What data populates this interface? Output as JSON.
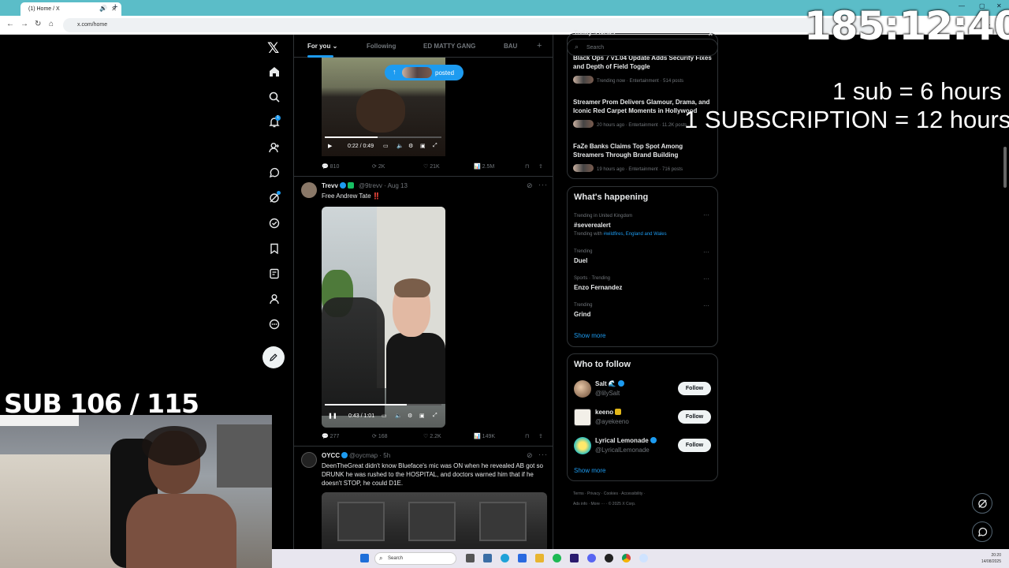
{
  "browser": {
    "tab_title": "(1) Home / X",
    "url": "x.com/home"
  },
  "feed": {
    "tabs": [
      {
        "label": "For you"
      },
      {
        "label": "Following"
      },
      {
        "label": "ED MATTY GANG"
      },
      {
        "label": "BAU"
      }
    ],
    "posted_pill": "posted",
    "tweet1": {
      "video_time": "0:22 / 0:49",
      "replies": "810",
      "reposts": "2K",
      "likes": "21K",
      "views": "2.5M"
    },
    "tweet2": {
      "name": "Trevv",
      "handle": "@9trevv",
      "date": "· Aug 13",
      "text": "Free Andrew Tate ‼️",
      "video_time": "0:43 / 1:01",
      "video_progress": 0.7,
      "replies": "277",
      "reposts": "168",
      "likes": "2.2K",
      "views": "149K"
    },
    "tweet3": {
      "name": "OYCC",
      "handle": "@oycmap",
      "date": "· 5h",
      "text": "DeenTheGreat didn't know Blueface's mic was ON when he revealed AB got so DRUNK he was rushed to the HOSPITAL, and doctors warned him that if he doesn't STOP, he could D1E."
    }
  },
  "sidebar": {
    "search_placeholder": "Search",
    "panel_header": "Today's News",
    "news": [
      {
        "title": "Black Ops 7 v1.04 Update Adds Security Fixes and Depth of Field Toggle",
        "meta": "Trending now · Entertainment · 514 posts"
      },
      {
        "title": "Streamer Prom Delivers Glamour, Drama, and Iconic Red Carpet Moments in Hollywood",
        "meta": "20 hours ago · Entertainment · 11.2K posts"
      },
      {
        "title": "FaZe Banks Claims Top Spot Among Streamers Through Brand Building",
        "meta": "19 hours ago · Entertainment · 716 posts"
      }
    ],
    "whats_happening_title": "What's happening",
    "trends": [
      {
        "label": "Trending in United Kingdom",
        "name": "#severealert",
        "with_prefix": "Trending with",
        "with": "#wildfires, England and Wales"
      },
      {
        "label": "Trending",
        "name": "Duel"
      },
      {
        "label": "Sports · Trending",
        "name": "Enzo Fernandez"
      },
      {
        "label": "Trending",
        "name": "Grind"
      }
    ],
    "show_more": "Show more",
    "who_to_follow_title": "Who to follow",
    "follow": [
      {
        "name": "Salt 🌊",
        "handle": "@lilySalt",
        "button": "Follow"
      },
      {
        "name": "keeno",
        "handle": "@ayekeeno",
        "button": "Follow"
      },
      {
        "name": "Lyrical Lemonade",
        "handle": "@LyricalLemonade",
        "button": "Follow"
      }
    ],
    "show_more_2": "Show more",
    "footer_line1": "Terms  ·  Privacy  ·  Cookies  ·  Accessibility  ·",
    "footer_line2": "Ads info  ·  More ···  ·  © 2025 X Corp."
  },
  "overlay": {
    "timer": "185:12:40",
    "sub_line1": "1 sub = 6 hours",
    "sub_line2": "1 SUBSCRIPTION = 12 hours",
    "sub_count": "SUB 106 / 115"
  },
  "taskbar": {
    "search": "Search",
    "time": "20:20",
    "date": "14/08/2025"
  },
  "colors": {
    "accent": "#1d9bf0",
    "background": "#000000",
    "border": "#2f3336",
    "tabbar": "#5bbdc8"
  }
}
